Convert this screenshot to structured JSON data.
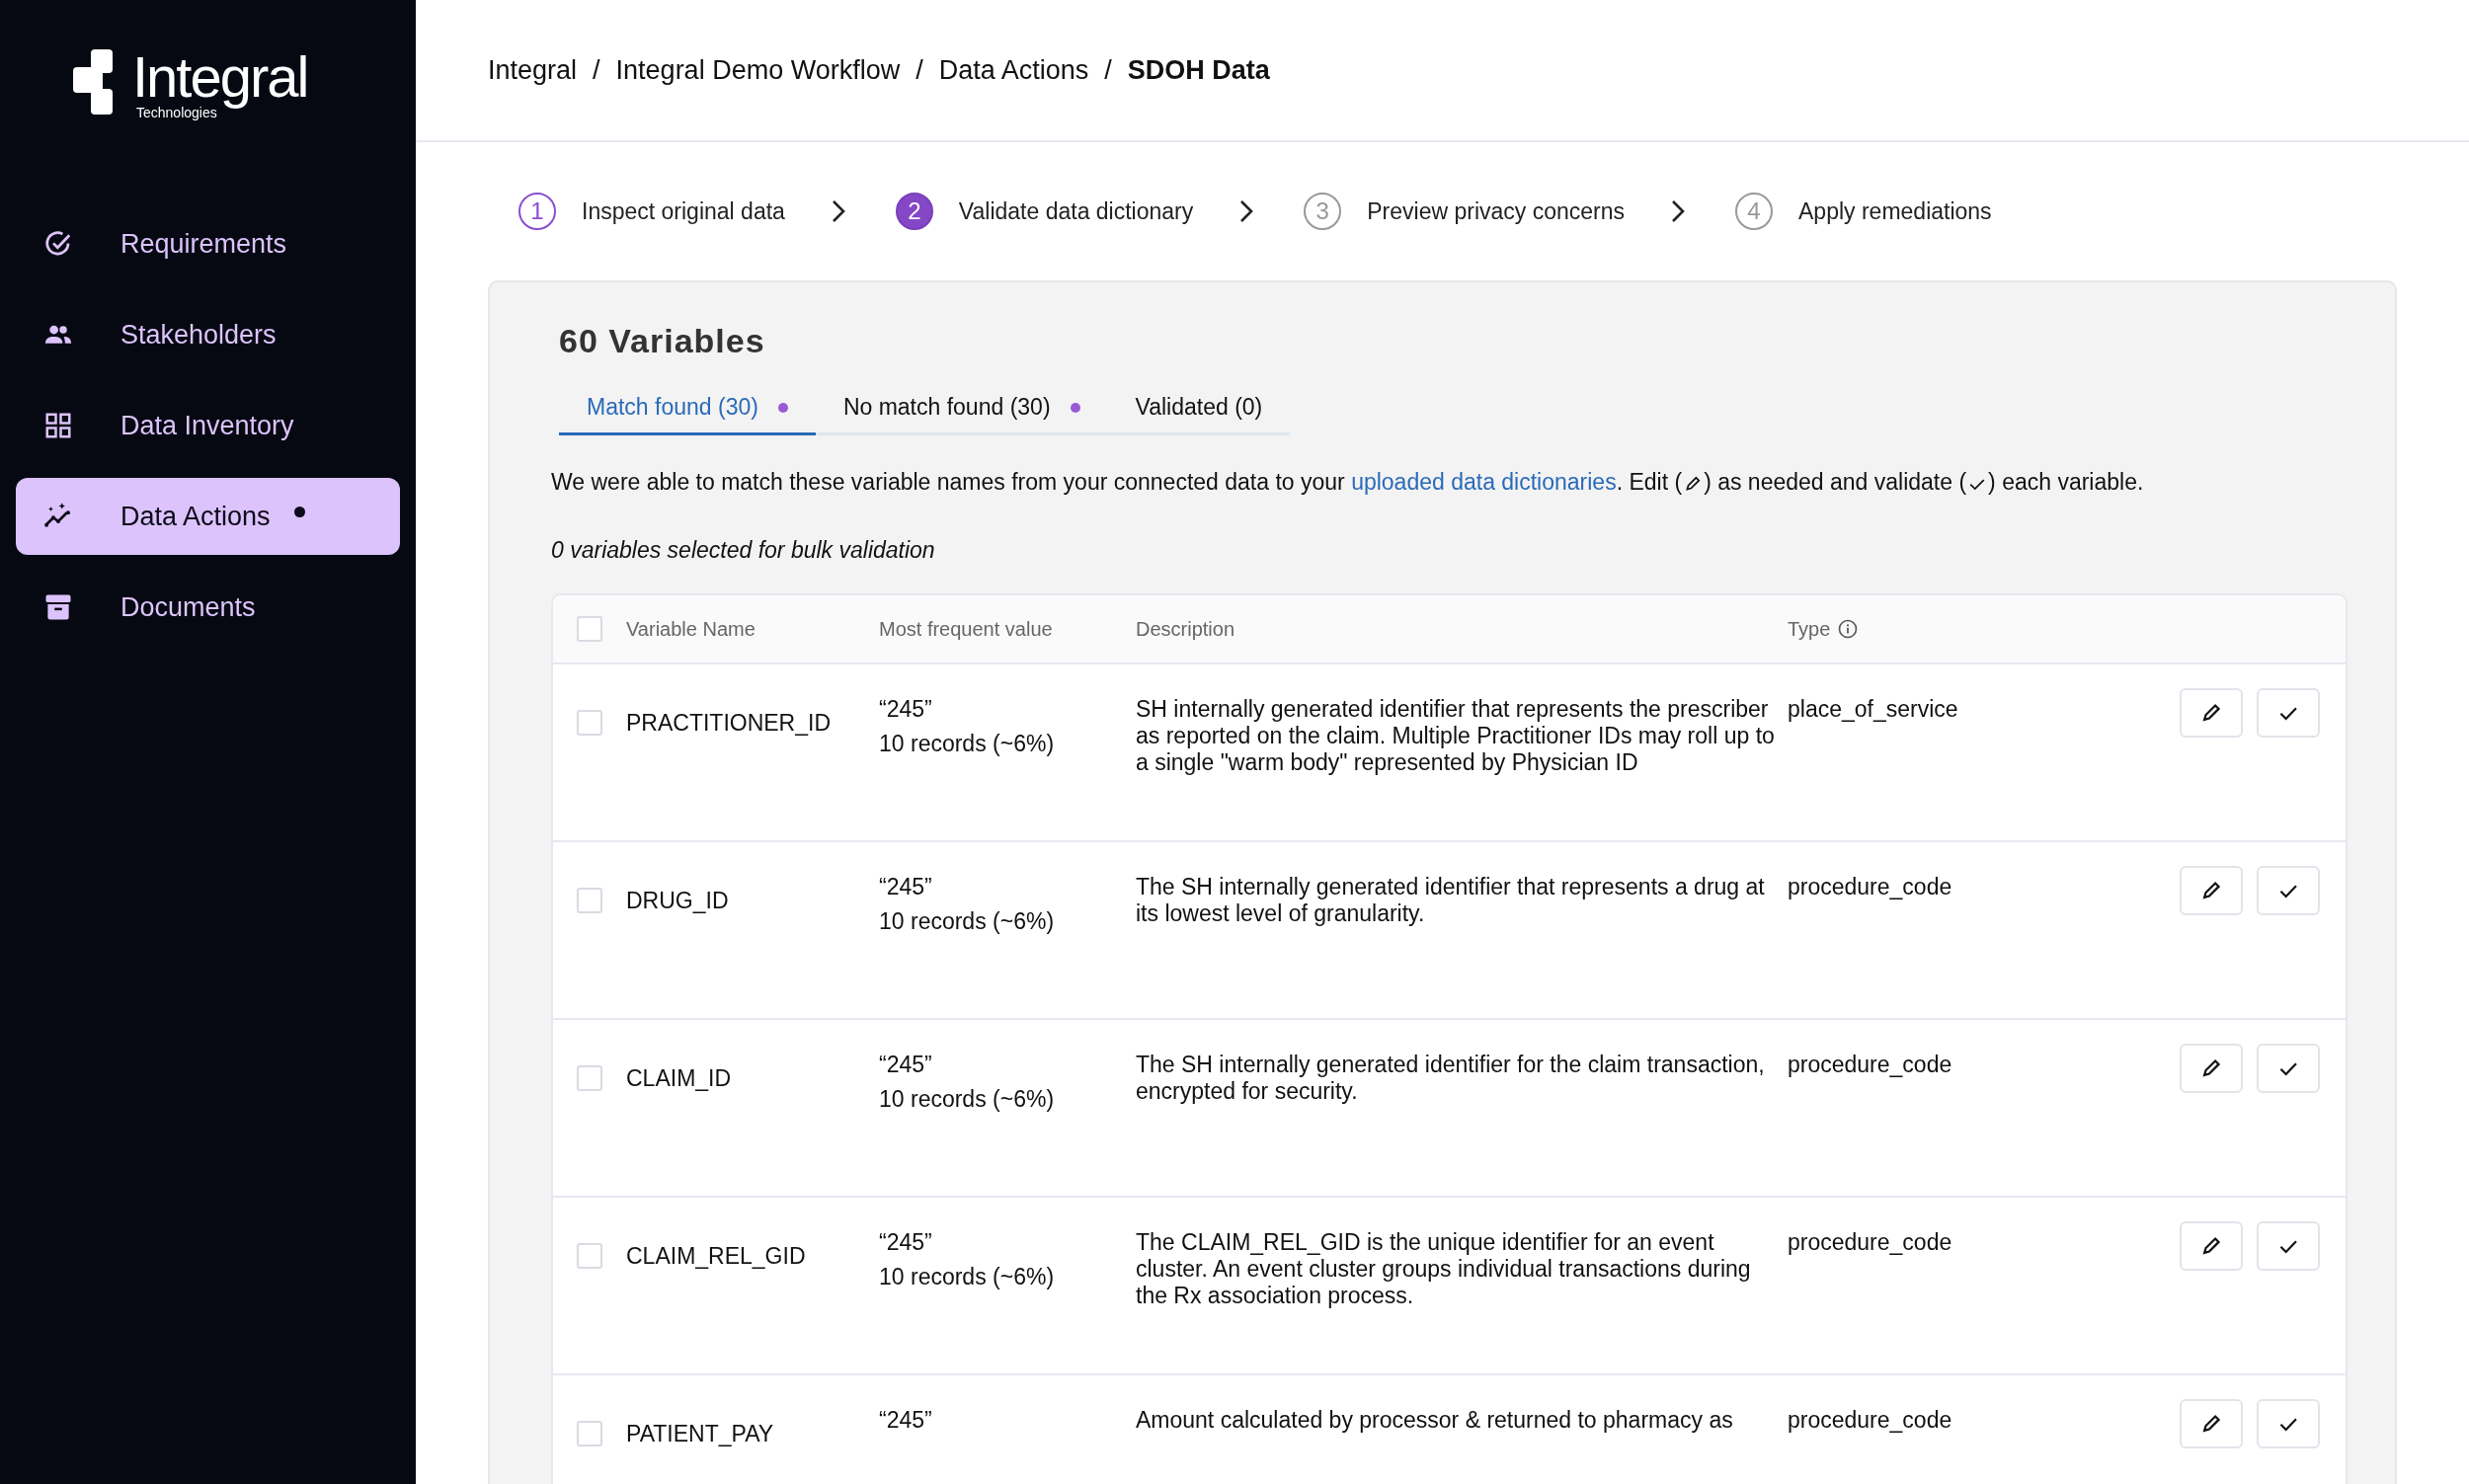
{
  "sidebar": {
    "logo": {
      "name": "Integral",
      "subtitle": "Technologies"
    },
    "items": [
      {
        "label": "Requirements",
        "selected": false,
        "dot": false
      },
      {
        "label": "Stakeholders",
        "selected": false,
        "dot": false
      },
      {
        "label": "Data Inventory",
        "selected": false,
        "dot": false
      },
      {
        "label": "Data Actions",
        "selected": true,
        "dot": true
      },
      {
        "label": "Documents",
        "selected": false,
        "dot": false
      }
    ]
  },
  "breadcrumb": {
    "separator": "/",
    "items": [
      "Integral",
      "Integral Demo Workflow",
      "Data Actions",
      "SDOH Data"
    ]
  },
  "steps": [
    {
      "number": "1",
      "label": "Inspect original data",
      "done": true,
      "selected": false
    },
    {
      "number": "2",
      "label": "Validate data dictionary",
      "done": false,
      "selected": true
    },
    {
      "number": "3",
      "label": "Preview privacy concerns",
      "done": false,
      "selected": false
    },
    {
      "number": "4",
      "label": "Apply remediations",
      "done": false,
      "selected": false
    }
  ],
  "card": {
    "title": "60 Variables",
    "tabs": [
      {
        "label": "Match found (30)",
        "selected": true,
        "dot": true
      },
      {
        "label": "No match found (30)",
        "selected": false,
        "dot": true
      },
      {
        "label": "Validated (0)",
        "selected": false,
        "dot": false
      }
    ],
    "instructions": [
      {
        "kind": "text",
        "text": "We were able to match these variable names from your connected data to your "
      },
      {
        "kind": "link",
        "text": "uploaded data dictionaries"
      },
      {
        "kind": "text",
        "text": ". Edit ("
      },
      {
        "kind": "edit-icon"
      },
      {
        "kind": "text",
        "text": ") as needed and validate ("
      },
      {
        "kind": "check-icon"
      },
      {
        "kind": "text",
        "text": ") each variable."
      }
    ],
    "selection_note": "0 variables selected for bulk validation",
    "table": {
      "select_all_checked": false,
      "columns": [
        "Variable Name",
        "Most frequent value",
        "Description",
        "Type"
      ],
      "rows": [
        {
          "checked": false,
          "name": "PRACTITIONER_ID",
          "value": "“245”",
          "records": "10 records (~6%)",
          "description": "SH internally generated identifier that represents the prescriber as reported on the claim. Multiple Practitioner IDs may roll up to a single \"warm body\" represented by Physician ID",
          "type": "place_of_service"
        },
        {
          "checked": false,
          "name": "DRUG_ID",
          "value": "“245”",
          "records": "10 records (~6%)",
          "description": "The SH internally generated identifier that represents a drug at its lowest level of granularity.",
          "type": "procedure_code"
        },
        {
          "checked": false,
          "name": "CLAIM_ID",
          "value": "“245”",
          "records": "10 records (~6%)",
          "description": "The SH internally generated identifier for the claim transaction, encrypted for security.",
          "type": "procedure_code"
        },
        {
          "checked": false,
          "name": "CLAIM_REL_GID",
          "value": "“245”",
          "records": "10 records (~6%)",
          "description": "The CLAIM_REL_GID is the unique identifier for an event cluster. An event cluster groups individual transactions during the Rx association process.",
          "type": "procedure_code"
        },
        {
          "checked": false,
          "name": "PATIENT_PAY",
          "value": "“245”",
          "description": "Amount calculated by processor & returned to pharmacy as",
          "type": "procedure_code"
        }
      ]
    }
  }
}
